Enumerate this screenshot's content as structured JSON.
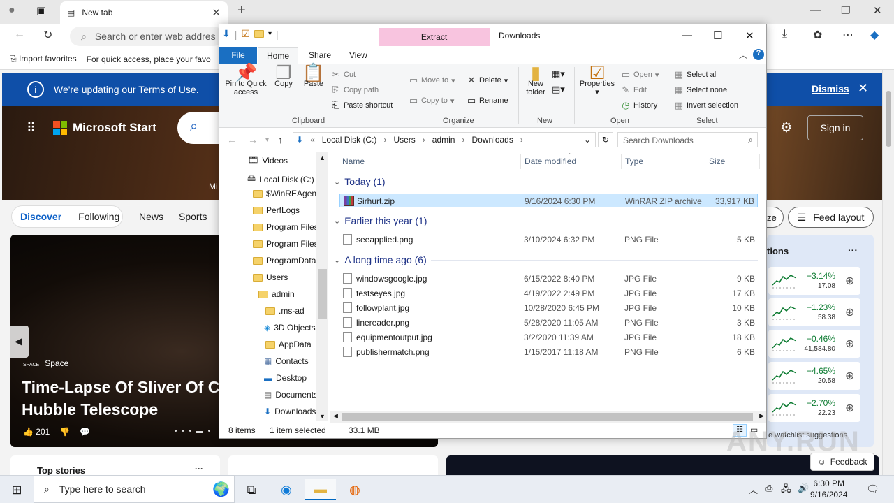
{
  "browser": {
    "tab_title": "New tab",
    "address_placeholder": "Search or enter web addres",
    "favorites": [
      "Import favorites",
      "For quick access, place your favo"
    ],
    "terms_banner": "We're updating our Terms of Use.",
    "dismiss": "Dismiss"
  },
  "msn": {
    "brand": "Microsoft Start",
    "sign_in": "Sign in",
    "tabs": [
      "Discover",
      "Following"
    ],
    "nav": [
      "News",
      "Sports"
    ],
    "ze_label": "ze",
    "feed_layout": "Feed layout",
    "mi_label": "Mi",
    "story": {
      "source": "Space",
      "headline": "Time-Lapse Of Sliver Of Cy Hubble Telescope",
      "likes": "201"
    },
    "watchlist": {
      "title": "tions",
      "items": [
        {
          "pct": "+3.14%",
          "val": "17.08"
        },
        {
          "pct": "+1.23%",
          "val": "58.38"
        },
        {
          "pct": "+0.46%",
          "val": "41,584.80"
        },
        {
          "pct": "+4.65%",
          "val": "20.58"
        },
        {
          "pct": "+2.70%",
          "val": "22.23"
        }
      ],
      "suggestions": "e watchlist suggestions"
    },
    "top_stories": "Top stories",
    "feedback": "Feedback"
  },
  "explorer": {
    "extract_tab": "Extract",
    "title": "Downloads",
    "ribbon_tabs": {
      "file": "File",
      "home": "Home",
      "share": "Share",
      "view": "View"
    },
    "clipboard": {
      "pin": "Pin to Quick access",
      "copy": "Copy",
      "paste": "Paste",
      "cut": "Cut",
      "copy_path": "Copy path",
      "paste_shortcut": "Paste shortcut",
      "label": "Clipboard"
    },
    "organize": {
      "move_to": "Move to",
      "copy_to": "Copy to",
      "delete": "Delete",
      "rename": "Rename",
      "label": "Organize"
    },
    "new": {
      "new_folder": "New folder",
      "label": "New"
    },
    "open": {
      "properties": "Properties",
      "open": "Open",
      "edit": "Edit",
      "history": "History",
      "label": "Open"
    },
    "select": {
      "select_all": "Select all",
      "select_none": "Select none",
      "invert": "Invert selection",
      "label": "Select"
    },
    "path": [
      "Local Disk (C:)",
      "Users",
      "admin",
      "Downloads"
    ],
    "search_placeholder": "Search Downloads",
    "nav_items": [
      {
        "label": "Videos"
      },
      {
        "label": "Local Disk (C:)"
      },
      {
        "label": "$WinREAgent"
      },
      {
        "label": "PerfLogs"
      },
      {
        "label": "Program Files"
      },
      {
        "label": "Program Files"
      },
      {
        "label": "ProgramData"
      },
      {
        "label": "Users"
      },
      {
        "label": "admin"
      },
      {
        "label": ".ms-ad"
      },
      {
        "label": "3D Objects"
      },
      {
        "label": "AppData"
      },
      {
        "label": "Contacts"
      },
      {
        "label": "Desktop"
      },
      {
        "label": "Documents"
      },
      {
        "label": "Downloads"
      }
    ],
    "columns": {
      "name": "Name",
      "date": "Date modified",
      "type": "Type",
      "size": "Size"
    },
    "groups": [
      {
        "label": "Today (1)",
        "files": [
          {
            "name": "Sirhurt.zip",
            "date": "9/16/2024 6:30 PM",
            "type": "WinRAR ZIP archive",
            "size": "33,917 KB",
            "selected": true
          }
        ]
      },
      {
        "label": "Earlier this year (1)",
        "files": [
          {
            "name": "seeapplied.png",
            "date": "3/10/2024 6:32 PM",
            "type": "PNG File",
            "size": "5 KB"
          }
        ]
      },
      {
        "label": "A long time ago (6)",
        "files": [
          {
            "name": "windowsgoogle.jpg",
            "date": "6/15/2022 8:40 PM",
            "type": "JPG File",
            "size": "9 KB"
          },
          {
            "name": "testseyes.jpg",
            "date": "4/19/2022 2:49 PM",
            "type": "JPG File",
            "size": "17 KB"
          },
          {
            "name": "followplant.jpg",
            "date": "10/28/2020 6:45 PM",
            "type": "JPG File",
            "size": "10 KB"
          },
          {
            "name": "linereader.png",
            "date": "5/28/2020 11:05 AM",
            "type": "PNG File",
            "size": "3 KB"
          },
          {
            "name": "equipmentoutput.jpg",
            "date": "3/2/2020 11:39 AM",
            "type": "JPG File",
            "size": "18 KB"
          },
          {
            "name": "publishermatch.png",
            "date": "1/15/2017 11:18 AM",
            "type": "PNG File",
            "size": "6 KB"
          }
        ]
      }
    ],
    "status": {
      "items": "8 items",
      "selected": "1 item selected",
      "size": "33.1 MB"
    }
  },
  "taskbar": {
    "search": "Type here to search",
    "time": "6:30 PM",
    "date": "9/16/2024"
  },
  "colors": {
    "accent": "#1a6fc2",
    "selection": "#cce8ff",
    "terms_bar": "#0f4fa8",
    "extract_tab": "#f8c4df"
  }
}
